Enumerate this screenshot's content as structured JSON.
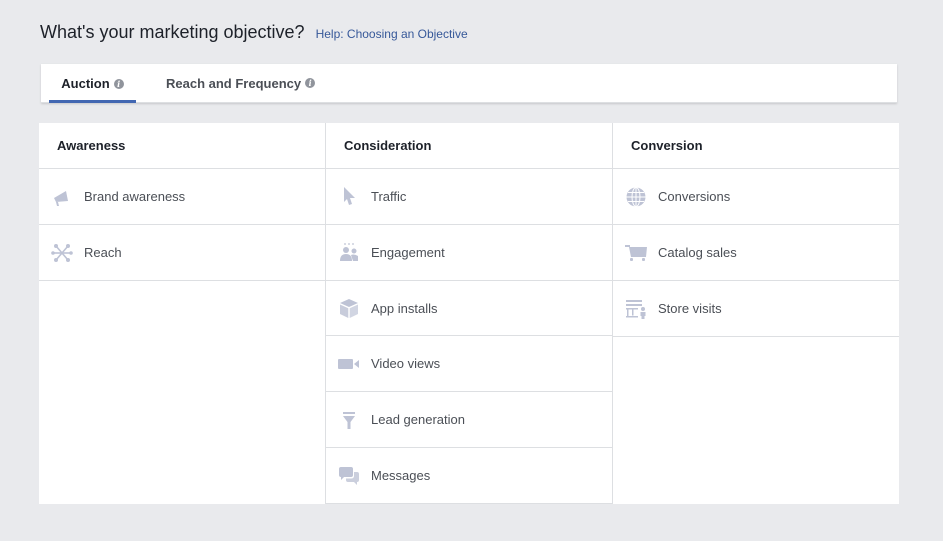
{
  "header": {
    "title": "What's your marketing objective?",
    "help_link": "Help: Choosing an Objective"
  },
  "tabs": [
    {
      "label": "Auction",
      "active": true,
      "info_icon": "info-icon"
    },
    {
      "label": "Reach and Frequency",
      "active": false,
      "info_icon": "info-icon"
    }
  ],
  "columns": [
    {
      "header": "Awareness",
      "items": [
        {
          "label": "Brand awareness",
          "icon": "megaphone-icon"
        },
        {
          "label": "Reach",
          "icon": "reach-network-icon"
        }
      ]
    },
    {
      "header": "Consideration",
      "items": [
        {
          "label": "Traffic",
          "icon": "cursor-icon"
        },
        {
          "label": "Engagement",
          "icon": "people-icon"
        },
        {
          "label": "App installs",
          "icon": "box-icon"
        },
        {
          "label": "Video views",
          "icon": "video-camera-icon"
        },
        {
          "label": "Lead generation",
          "icon": "funnel-icon"
        },
        {
          "label": "Messages",
          "icon": "chat-bubbles-icon"
        }
      ]
    },
    {
      "header": "Conversion",
      "items": [
        {
          "label": "Conversions",
          "icon": "globe-icon"
        },
        {
          "label": "Catalog sales",
          "icon": "cart-icon"
        },
        {
          "label": "Store visits",
          "icon": "store-icon"
        }
      ]
    }
  ],
  "colors": {
    "accent": "#4267b2",
    "link": "#365899",
    "icon": "#bec3d5",
    "background": "#e9eaed"
  }
}
